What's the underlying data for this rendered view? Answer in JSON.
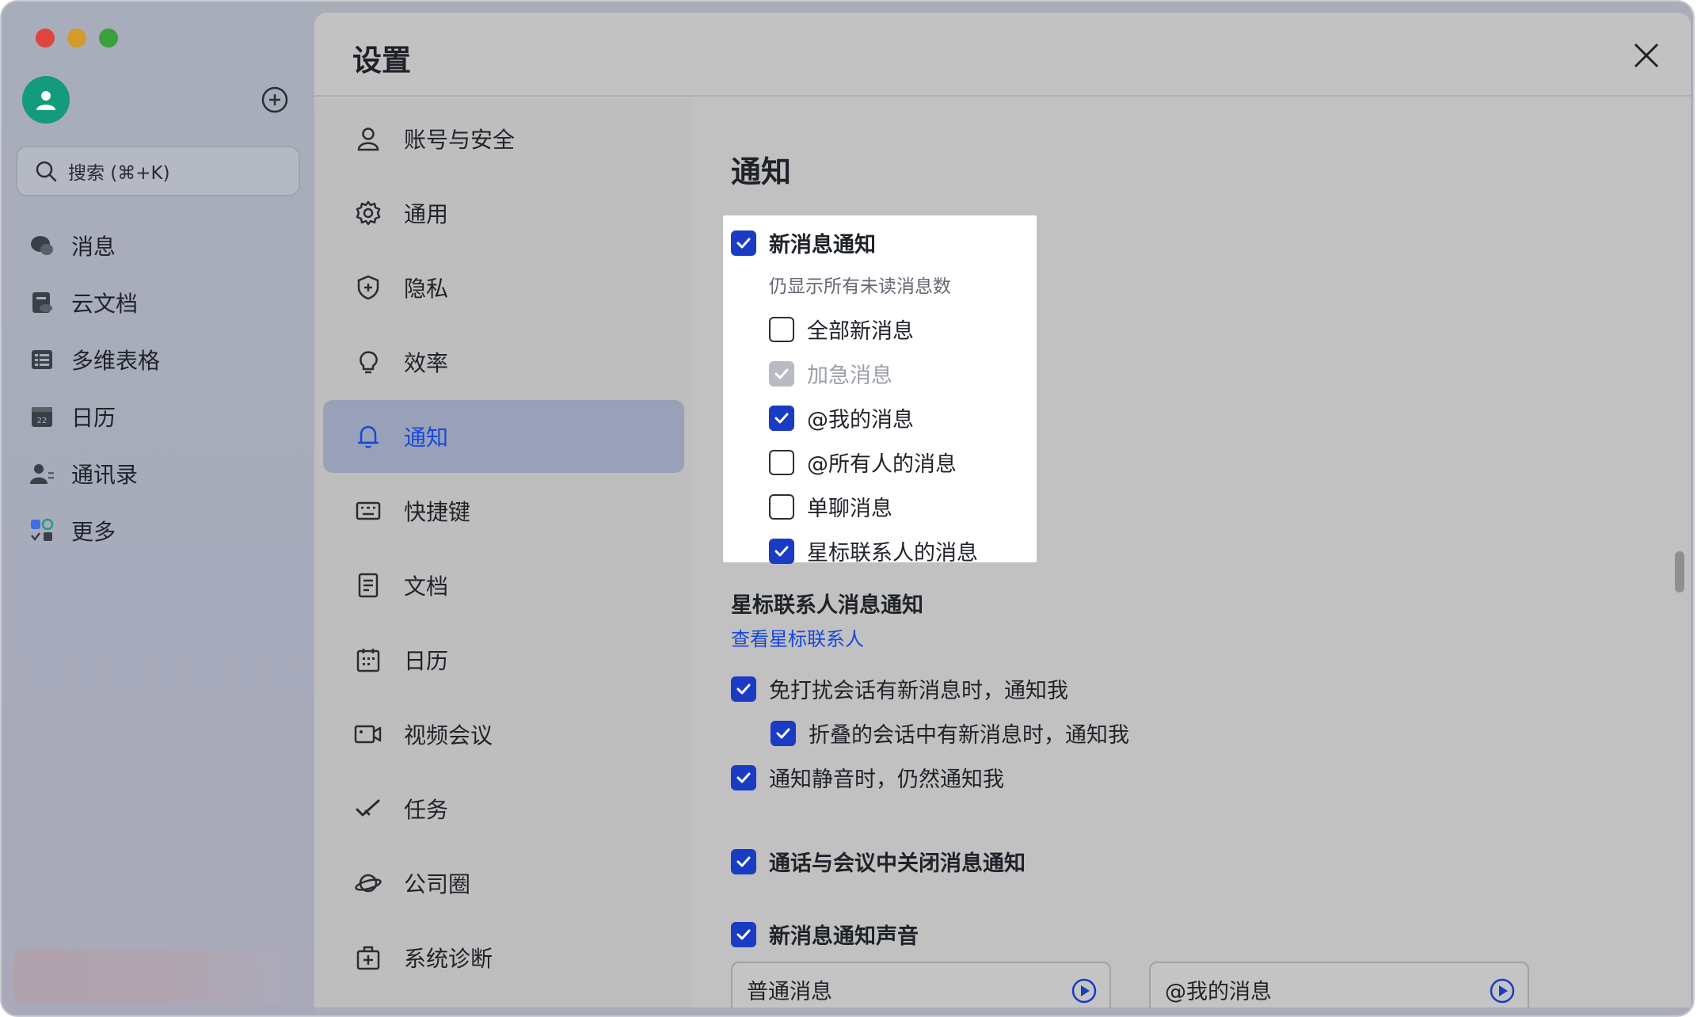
{
  "sidebar": {
    "search_placeholder": "搜索 (⌘+K)",
    "items": [
      {
        "label": "消息",
        "icon": "message-icon"
      },
      {
        "label": "云文档",
        "icon": "cloud-doc-icon"
      },
      {
        "label": "多维表格",
        "icon": "base-table-icon"
      },
      {
        "label": "日历",
        "icon": "calendar-icon"
      },
      {
        "label": "通讯录",
        "icon": "contacts-icon"
      },
      {
        "label": "更多",
        "icon": "more-apps-icon"
      }
    ]
  },
  "dialog": {
    "title": "设置",
    "nav": [
      {
        "label": "账号与安全",
        "icon": "user-icon"
      },
      {
        "label": "通用",
        "icon": "gear-icon"
      },
      {
        "label": "隐私",
        "icon": "shield-icon"
      },
      {
        "label": "效率",
        "icon": "lightbulb-icon"
      },
      {
        "label": "通知",
        "icon": "bell-icon",
        "active": true
      },
      {
        "label": "快捷键",
        "icon": "keyboard-icon"
      },
      {
        "label": "文档",
        "icon": "document-icon"
      },
      {
        "label": "日历",
        "icon": "calendar-icon"
      },
      {
        "label": "视频会议",
        "icon": "video-icon"
      },
      {
        "label": "任务",
        "icon": "task-icon"
      },
      {
        "label": "公司圈",
        "icon": "planet-icon"
      },
      {
        "label": "系统诊断",
        "icon": "diagnose-icon"
      }
    ]
  },
  "notifications": {
    "title": "通知",
    "new_message": {
      "label": "新消息通知",
      "checked": true
    },
    "hint": "仍显示所有未读消息数",
    "options": [
      {
        "label": "全部新消息",
        "checked": false
      },
      {
        "label": "加急消息",
        "checked": true,
        "disabled": true
      },
      {
        "label": "@我的消息",
        "checked": true
      },
      {
        "label": "@所有人的消息",
        "checked": false
      },
      {
        "label": "单聊消息",
        "checked": false
      },
      {
        "label": "星标联系人的消息",
        "checked": true
      }
    ],
    "starred_title": "星标联系人消息通知",
    "starred_link": "查看星标联系人",
    "dnd": {
      "label": "免打扰会话有新消息时，通知我",
      "checked": true
    },
    "folded": {
      "label": "折叠的会话中有新消息时，通知我",
      "checked": true
    },
    "muted": {
      "label": "通知静音时，仍然通知我",
      "checked": true
    },
    "meeting": {
      "label": "通话与会议中关闭消息通知",
      "checked": true
    },
    "sound": {
      "label": "新消息通知声音",
      "checked": true
    },
    "sound_normal": "普通消息",
    "sound_mention": "@我的消息"
  },
  "colors": {
    "accent": "#1a3bc4",
    "link": "#1848d8",
    "avatar": "#149a7c"
  }
}
